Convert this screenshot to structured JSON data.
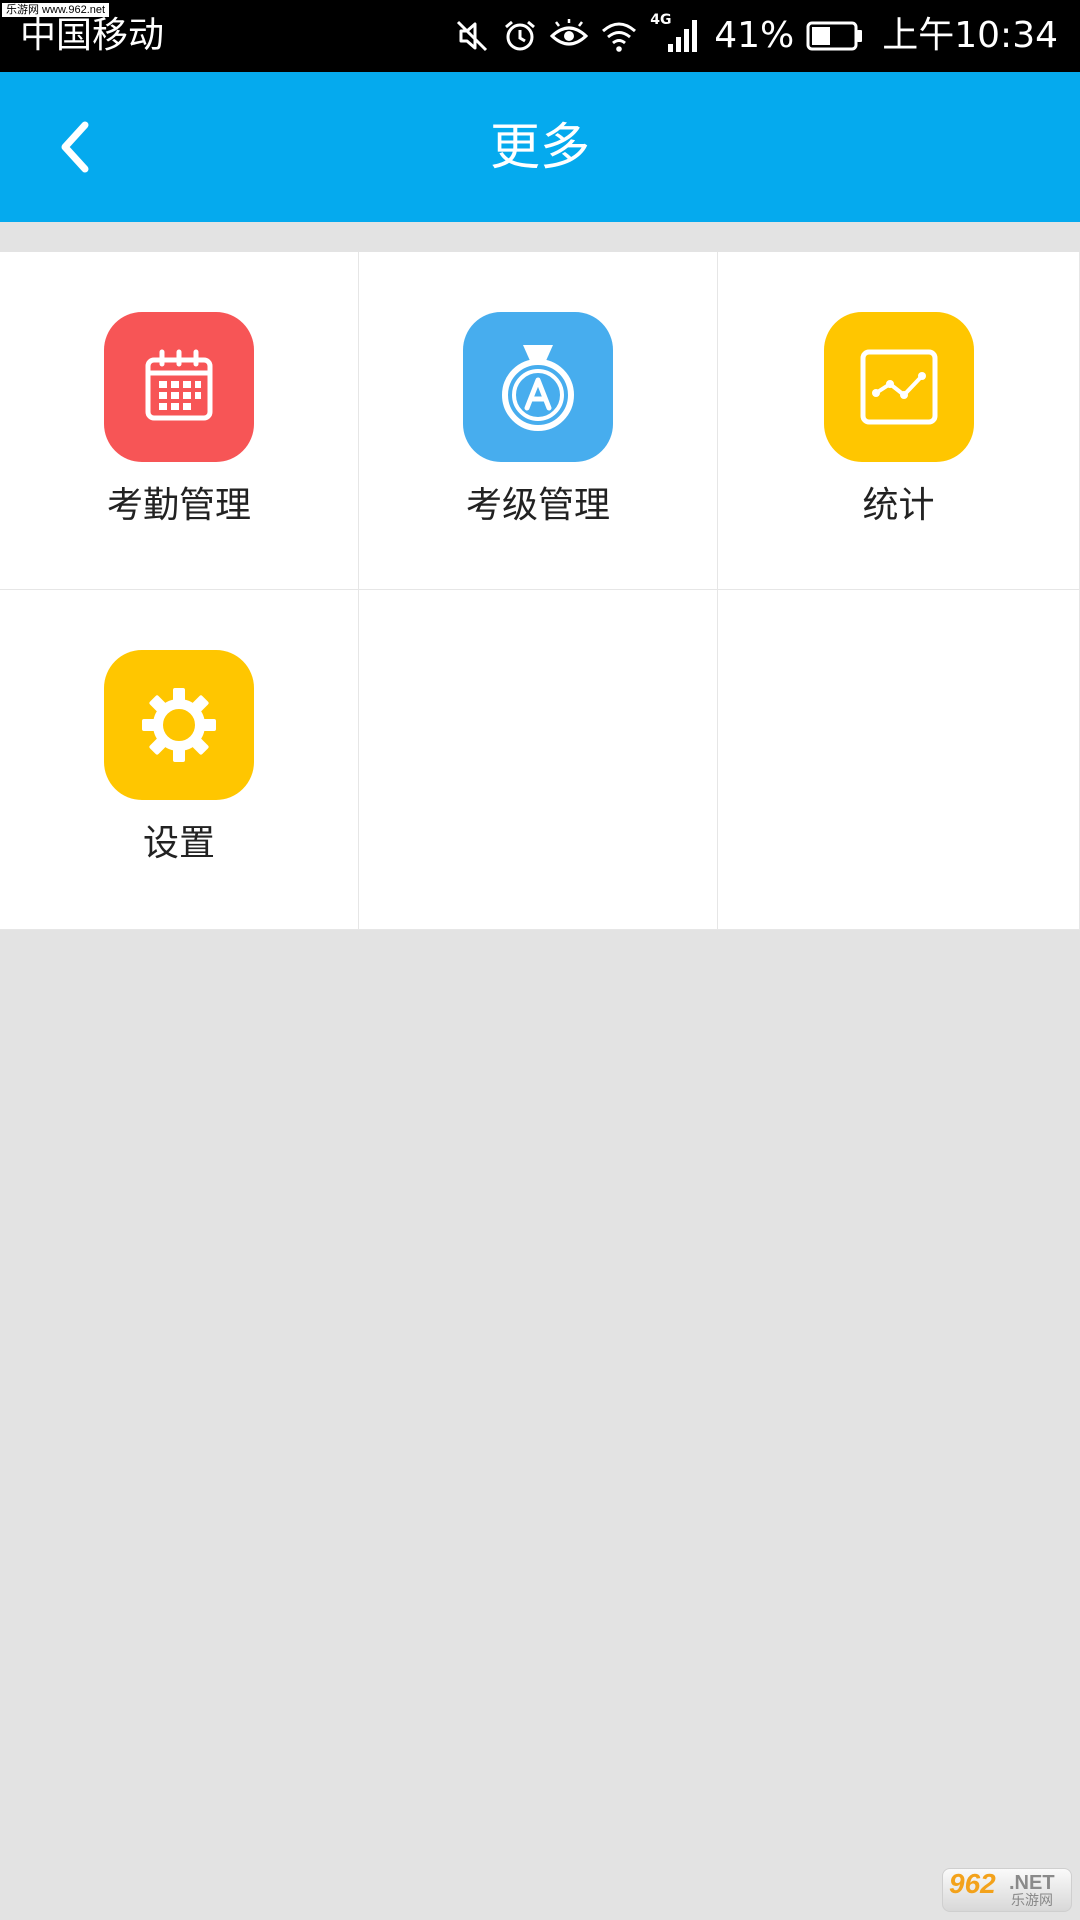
{
  "status_bar": {
    "watermark": "乐游网 www.962.net",
    "carrier": "中国移动",
    "network": "4G",
    "battery": "41%",
    "time": "上午10:34",
    "icons": [
      "mute-icon",
      "alarm-icon",
      "eye-icon",
      "wifi-icon",
      "signal-icon",
      "battery-icon"
    ]
  },
  "header": {
    "title": "更多",
    "back_icon": "chevron-left-icon",
    "background": "#05aaee"
  },
  "grid": {
    "items": [
      {
        "label": "考勤管理",
        "icon": "calendar-icon",
        "color": "#f75556"
      },
      {
        "label": "考级管理",
        "icon": "medal-icon",
        "color": "#47adee"
      },
      {
        "label": "统计",
        "icon": "chart-icon",
        "color": "#ffc600"
      },
      {
        "label": "设置",
        "icon": "gear-icon",
        "color": "#ffc600"
      }
    ]
  },
  "footer_watermark": {
    "number": "962",
    "suffix": ".NET",
    "text": "乐游网"
  }
}
